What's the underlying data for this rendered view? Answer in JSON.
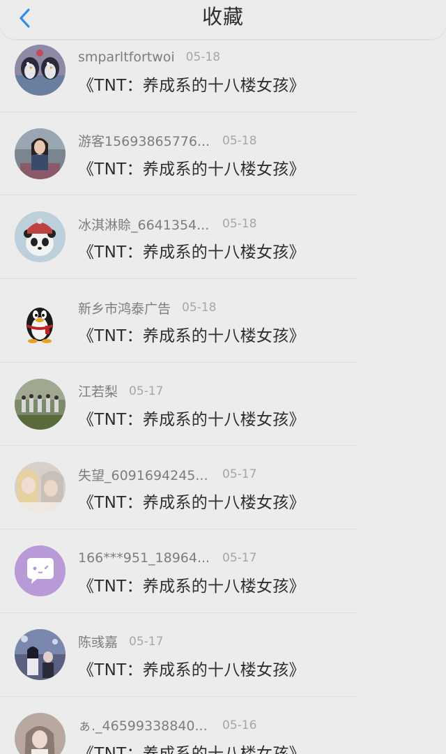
{
  "header": {
    "title": "收藏",
    "back_icon": "chevron-left-icon",
    "accent_color": "#2f8fe6"
  },
  "items": [
    {
      "user": "smparltfortwoi",
      "date": "05-18",
      "text": "《TNT：养成系的十八楼女孩》",
      "avatar": "penguins-illustration"
    },
    {
      "user": "游客15693865776...",
      "date": "05-18",
      "text": "《TNT：养成系的十八楼女孩》",
      "avatar": "girl-photo"
    },
    {
      "user": "冰淇淋賒_6641354...",
      "date": "05-18",
      "text": "《TNT：养成系的十八楼女孩》",
      "avatar": "panda-cartoon"
    },
    {
      "user": "新乡市鸿泰广告",
      "date": "05-18",
      "text": "《TNT：养成系的十八楼女孩》",
      "avatar": "qq-penguin"
    },
    {
      "user": "江若梨",
      "date": "05-17",
      "text": "《TNT：养成系的十八楼女孩》",
      "avatar": "group-photo"
    },
    {
      "user": "失望_6091694245...",
      "date": "05-17",
      "text": "《TNT：养成系的十八楼女孩》",
      "avatar": "girls-photo"
    },
    {
      "user": "166***951_18964...",
      "date": "05-17",
      "text": "《TNT：养成系的十八楼女孩》",
      "avatar": "chat-bubble"
    },
    {
      "user": "陈彧嘉",
      "date": "05-17",
      "text": "《TNT：养成系的十八楼女孩》",
      "avatar": "couple-photo"
    },
    {
      "user": "ぁ._46599338840...",
      "date": "05-16",
      "text": "《TNT：养成系的十八楼女孩》",
      "avatar": "portrait-photo"
    }
  ]
}
